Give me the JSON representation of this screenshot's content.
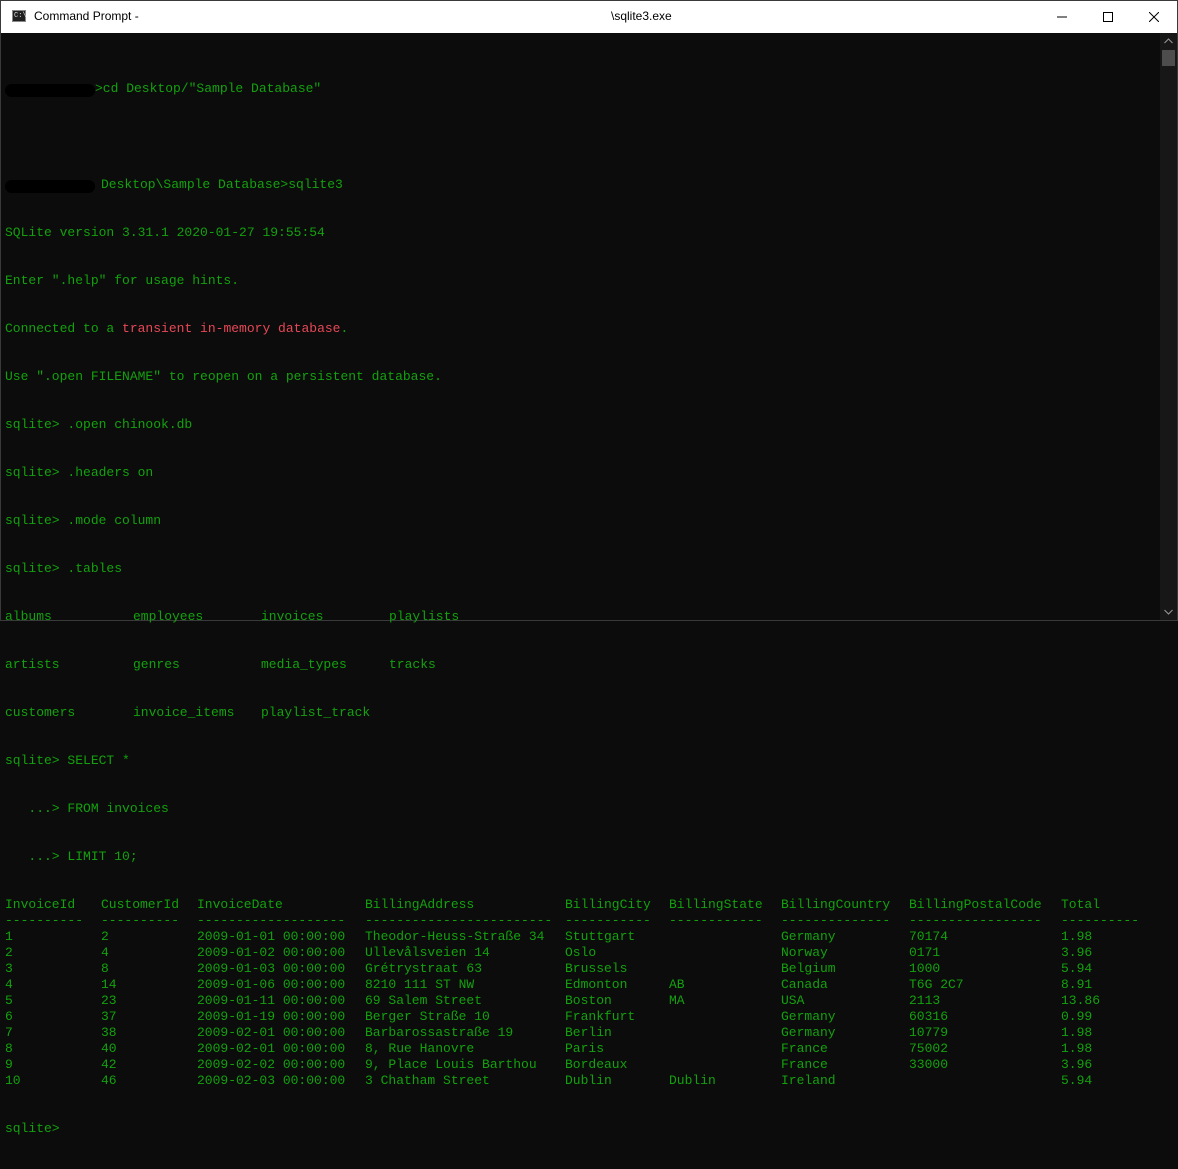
{
  "window": {
    "title_left": "Command Prompt - ",
    "title_center": "\\sqlite3.exe",
    "icon_text": "C:\\"
  },
  "console": {
    "prompt_path_1": ">cd Desktop/\"Sample Database\"",
    "prompt_path_2": "Desktop\\Sample Database>sqlite3",
    "version_line": "SQLite version 3.31.1 2020-01-27 19:55:54",
    "help_line": "Enter \".help\" for usage hints.",
    "connected_prefix": "Connected to a ",
    "connected_red": "transient in-memory database",
    "connected_suffix": ".",
    "open_hint": "Use \".open FILENAME\" to reopen on a persistent database.",
    "cmd_open": "sqlite> .open chinook.db",
    "cmd_headers": "sqlite> .headers on",
    "cmd_mode": "sqlite> .mode column",
    "cmd_tables": "sqlite> .tables",
    "tables_rows": [
      [
        "albums",
        "employees",
        "invoices",
        "playlists"
      ],
      [
        "artists",
        "genres",
        "media_types",
        "tracks"
      ],
      [
        "customers",
        "invoice_items",
        "playlist_track",
        ""
      ]
    ],
    "query_line_1": "sqlite> SELECT *",
    "query_line_2": "   ...> FROM invoices",
    "query_line_3": "   ...> LIMIT 10;",
    "final_prompt": "sqlite>"
  },
  "result": {
    "headers": [
      "InvoiceId",
      "CustomerId",
      "InvoiceDate",
      "BillingAddress",
      "BillingCity",
      "BillingState",
      "BillingCountry",
      "BillingPostalCode",
      "Total"
    ],
    "separators": [
      "----------",
      "----------",
      "-------------------",
      "------------------------",
      "-----------",
      "------------",
      "--------------",
      "-----------------",
      "----------"
    ],
    "rows": [
      [
        "1",
        "2",
        "2009-01-01 00:00:00",
        "Theodor-Heuss-Straße 34",
        "Stuttgart",
        "",
        "Germany",
        "70174",
        "1.98"
      ],
      [
        "2",
        "4",
        "2009-01-02 00:00:00",
        "Ullevålsveien 14",
        "Oslo",
        "",
        "Norway",
        "0171",
        "3.96"
      ],
      [
        "3",
        "8",
        "2009-01-03 00:00:00",
        "Grétrystraat 63",
        "Brussels",
        "",
        "Belgium",
        "1000",
        "5.94"
      ],
      [
        "4",
        "14",
        "2009-01-06 00:00:00",
        "8210 111 ST NW",
        "Edmonton",
        "AB",
        "Canada",
        "T6G 2C7",
        "8.91"
      ],
      [
        "5",
        "23",
        "2009-01-11 00:00:00",
        "69 Salem Street",
        "Boston",
        "MA",
        "USA",
        "2113",
        "13.86"
      ],
      [
        "6",
        "37",
        "2009-01-19 00:00:00",
        "Berger Straße 10",
        "Frankfurt",
        "",
        "Germany",
        "60316",
        "0.99"
      ],
      [
        "7",
        "38",
        "2009-02-01 00:00:00",
        "Barbarossastraße 19",
        "Berlin",
        "",
        "Germany",
        "10779",
        "1.98"
      ],
      [
        "8",
        "40",
        "2009-02-01 00:00:00",
        "8, Rue Hanovre",
        "Paris",
        "",
        "France",
        "75002",
        "1.98"
      ],
      [
        "9",
        "42",
        "2009-02-02 00:00:00",
        "9, Place Louis Barthou",
        "Bordeaux",
        "",
        "France",
        "33000",
        "3.96"
      ],
      [
        "10",
        "46",
        "2009-02-03 00:00:00",
        "3 Chatham Street",
        "Dublin",
        "Dublin",
        "Ireland",
        "",
        "5.94"
      ]
    ]
  },
  "colors": {
    "text_green": "#13a10e",
    "text_red": "#e74856",
    "background": "#0c0c0c"
  },
  "icons": [
    "console-icon",
    "minimize-icon",
    "maximize-icon",
    "close-icon",
    "scroll-up-icon",
    "scroll-down-icon"
  ]
}
